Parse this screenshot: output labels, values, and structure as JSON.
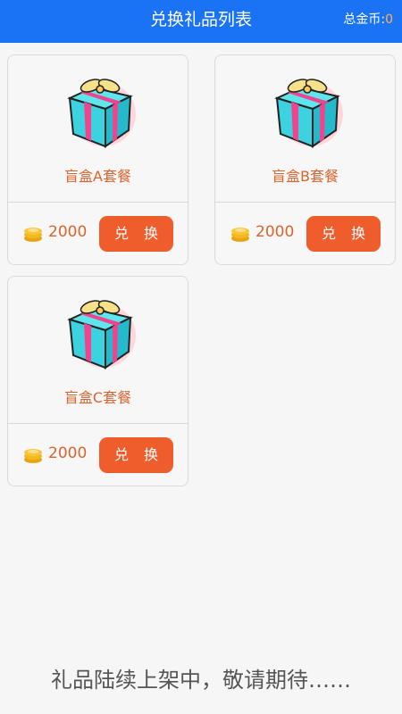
{
  "header": {
    "title": "兑换礼品列表",
    "total_label": "总金币:",
    "total_value": "0"
  },
  "cards": [
    {
      "name": "盲盒A套餐",
      "price": "2000",
      "button": "兑 换",
      "icon": "gift-box-icon"
    },
    {
      "name": "盲盒B套餐",
      "price": "2000",
      "button": "兑 换",
      "icon": "gift-box-icon"
    },
    {
      "name": "盲盒C套餐",
      "price": "2000",
      "button": "兑 换",
      "icon": "gift-box-icon"
    }
  ],
  "footer": {
    "text": "礼品陆续上架中，敬请期待……"
  },
  "colors": {
    "header_bg": "#1a73f5",
    "accent": "#f05d2c",
    "text_orange": "#d8642e",
    "coin_gold": "#f2b21a"
  }
}
